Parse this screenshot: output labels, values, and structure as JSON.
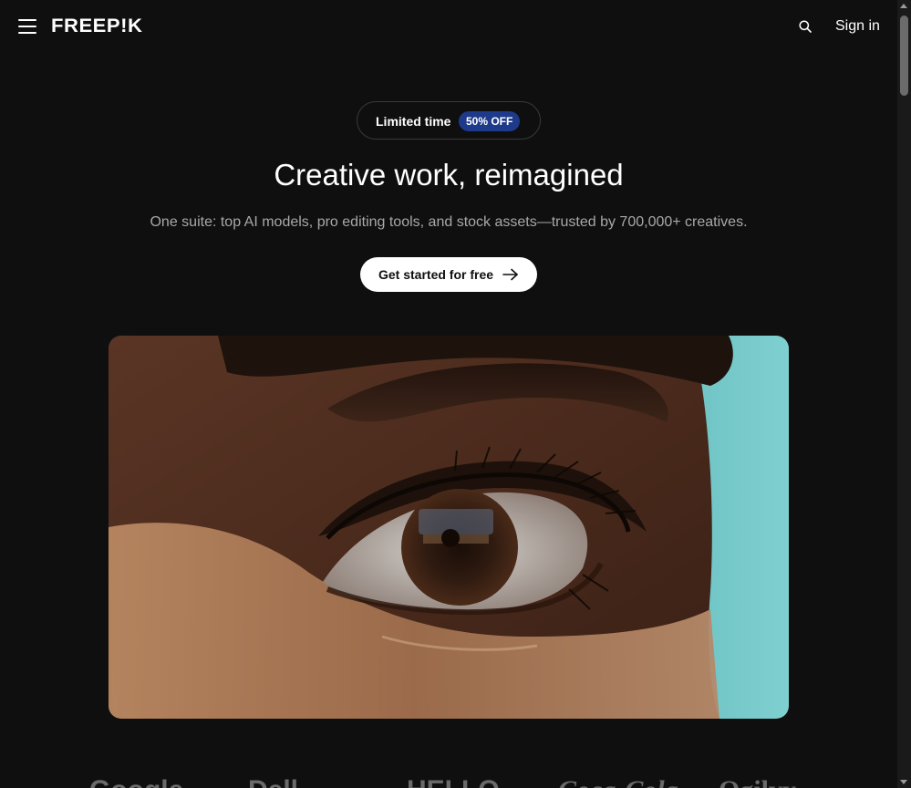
{
  "header": {
    "logo_text": "FREEP!K",
    "sign_in_label": "Sign in",
    "menu_icon": "hamburger-menu-icon",
    "search_icon": "search-icon"
  },
  "promo": {
    "label": "Limited time",
    "badge": "50% OFF",
    "badge_color": "#1e3a8a"
  },
  "hero": {
    "title": "Creative work, reimagined",
    "subtitle": "One suite: top AI models, pro editing tools, and stock assets—trusted by 700,000+ creatives.",
    "cta_label": "Get started for free",
    "cta_icon": "arrow-right-icon"
  },
  "brand_logos": [
    "Google",
    "Dell",
    "HELLO",
    "Coca-Cola",
    "Ogilvy"
  ],
  "colors": {
    "background": "#0f0f0f",
    "text_primary": "#ffffff",
    "text_secondary": "#a8a8a8",
    "cta_background": "#ffffff"
  }
}
